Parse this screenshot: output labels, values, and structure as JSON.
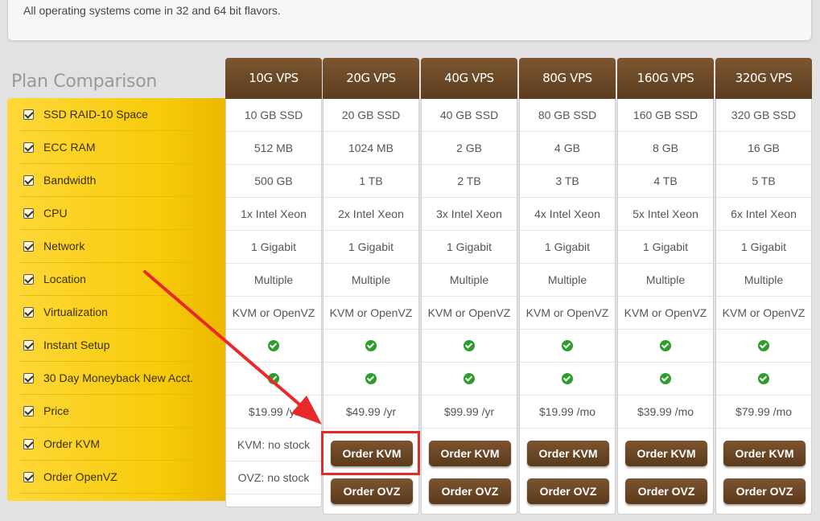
{
  "top_note": "All operating systems come in 32 and 64 bit flavors.",
  "plan_title": "Plan Comparison",
  "features": [
    "SSD RAID-10 Space",
    "ECC RAM",
    "Bandwidth",
    "CPU",
    "Network",
    "Location",
    "Virtualization",
    "Instant Setup",
    "30 Day Moneyback New Acct.",
    "Price",
    "Order KVM",
    "Order OpenVZ"
  ],
  "plans": [
    {
      "name": "10G VPS",
      "space": "10 GB SSD",
      "ram": "512 MB",
      "bandwidth": "500 GB",
      "cpu": "1x Intel Xeon",
      "network": "1 Gigabit",
      "location": "Multiple",
      "virtualization": "KVM or OpenVZ",
      "price": "$19.99 /yr",
      "kvm": "KVM: no stock",
      "ovz": "OVZ: no stock"
    },
    {
      "name": "20G VPS",
      "space": "20 GB SSD",
      "ram": "1024 MB",
      "bandwidth": "1 TB",
      "cpu": "2x Intel Xeon",
      "network": "1 Gigabit",
      "location": "Multiple",
      "virtualization": "KVM or OpenVZ",
      "price": "$49.99 /yr",
      "kvm": "Order KVM",
      "ovz": "Order OVZ"
    },
    {
      "name": "40G VPS",
      "space": "40 GB SSD",
      "ram": "2 GB",
      "bandwidth": "2 TB",
      "cpu": "3x Intel Xeon",
      "network": "1 Gigabit",
      "location": "Multiple",
      "virtualization": "KVM or OpenVZ",
      "price": "$99.99 /yr",
      "kvm": "Order KVM",
      "ovz": "Order OVZ"
    },
    {
      "name": "80G VPS",
      "space": "80 GB SSD",
      "ram": "4 GB",
      "bandwidth": "3 TB",
      "cpu": "4x Intel Xeon",
      "network": "1 Gigabit",
      "location": "Multiple",
      "virtualization": "KVM or OpenVZ",
      "price": "$19.99 /mo",
      "kvm": "Order KVM",
      "ovz": "Order OVZ"
    },
    {
      "name": "160G VPS",
      "space": "160 GB SSD",
      "ram": "8 GB",
      "bandwidth": "4 TB",
      "cpu": "5x Intel Xeon",
      "network": "1 Gigabit",
      "location": "Multiple",
      "virtualization": "KVM or OpenVZ",
      "price": "$39.99 /mo",
      "kvm": "Order KVM",
      "ovz": "Order OVZ"
    },
    {
      "name": "320G VPS",
      "space": "320 GB SSD",
      "ram": "16 GB",
      "bandwidth": "5 TB",
      "cpu": "6x Intel Xeon",
      "network": "1 Gigabit",
      "location": "Multiple",
      "virtualization": "KVM or OpenVZ",
      "price": "$79.99 /mo",
      "kvm": "Order KVM",
      "ovz": "Order OVZ"
    }
  ],
  "colors": {
    "header_brown": "#6b4726",
    "feature_yellow": "#f7cb0a",
    "check_green": "#2c9e2c",
    "annotation_red": "#e8292a"
  },
  "icons": {
    "check": "check-circle-icon",
    "feature": "checkbox-icon"
  }
}
